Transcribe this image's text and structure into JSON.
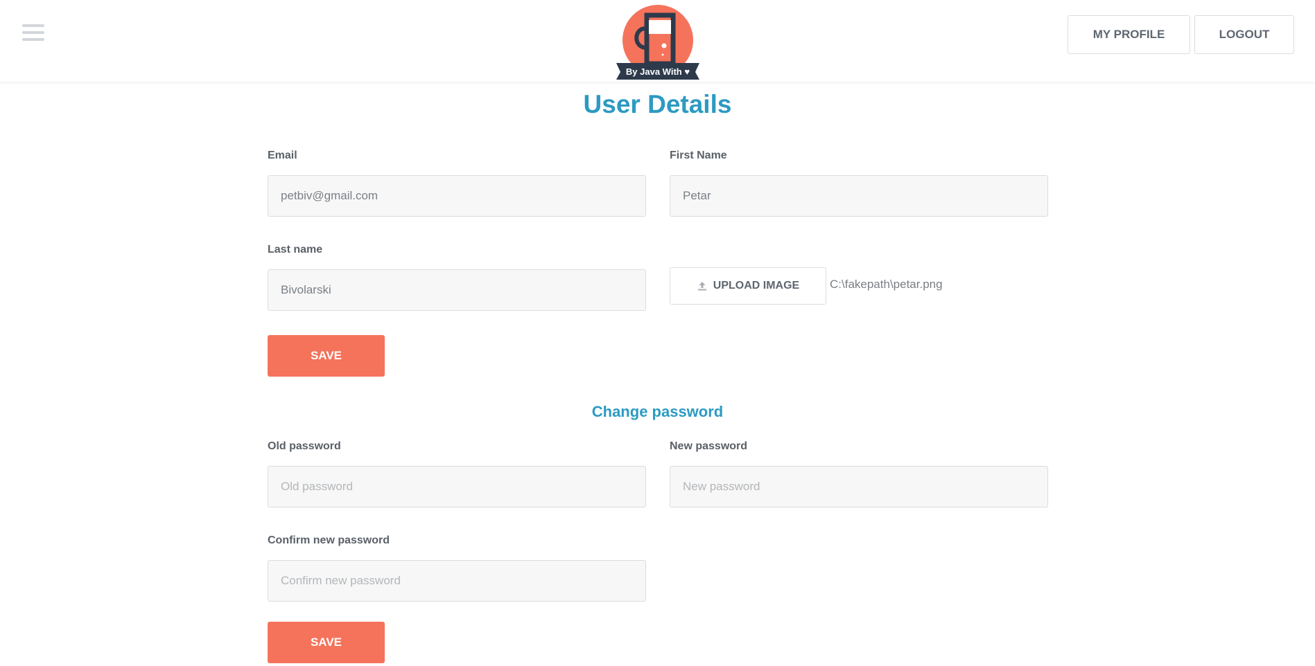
{
  "header": {
    "menu_icon": "hamburger-menu-icon",
    "logo_text": "By Java With ♥",
    "my_profile_label": "MY PROFILE",
    "logout_label": "LOGOUT"
  },
  "page": {
    "title": "User Details"
  },
  "user_form": {
    "email_label": "Email",
    "email_value": "petbiv@gmail.com",
    "first_name_label": "First Name",
    "first_name_value": "Petar",
    "last_name_label": "Last name",
    "last_name_value": "Bivolarski",
    "upload_label": "UPLOAD IMAGE",
    "upload_icon": "upload-icon",
    "file_name": "C:\\fakepath\\petar.png",
    "save_label": "SAVE"
  },
  "password_form": {
    "title": "Change password",
    "old_label": "Old password",
    "old_placeholder": "Old password",
    "new_label": "New password",
    "new_placeholder": "New password",
    "confirm_label": "Confirm new password",
    "confirm_placeholder": "Confirm new password",
    "save_label": "SAVE"
  },
  "colors": {
    "accent": "#2c9ac2",
    "button": "#f5735b",
    "logo_circle": "#f5735b",
    "logo_dark": "#2d3a4b"
  }
}
